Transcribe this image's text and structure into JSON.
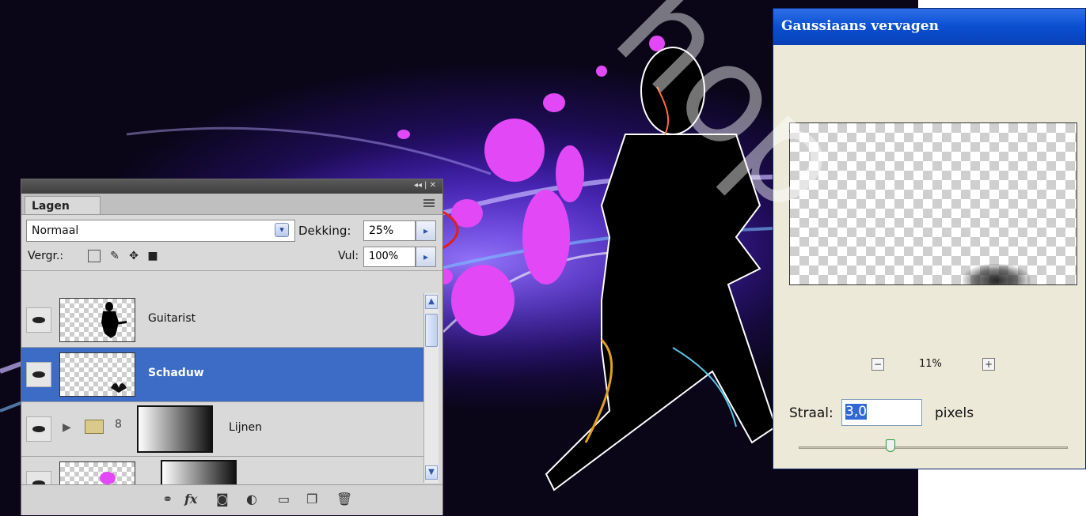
{
  "layers_panel": {
    "tab_label": "Lagen",
    "blend_mode": "Normaal",
    "opacity_label": "Dekking:",
    "opacity_value": "25%",
    "lock_label": "Vergr.:",
    "fill_label": "Vul:",
    "fill_value": "100%",
    "layers": [
      {
        "name": "Guitarist",
        "selected": false
      },
      {
        "name": "Schaduw",
        "selected": true
      },
      {
        "name": "Lijnen",
        "selected": false,
        "group": true
      }
    ],
    "footer_icons": [
      "link-icon",
      "fx-icon",
      "mask-icon",
      "adjustment-icon",
      "folder-icon",
      "new-layer-icon",
      "trash-icon"
    ]
  },
  "gauss_dialog": {
    "title": "Gaussiaans vervagen",
    "zoom": "11%",
    "radius_label": "Straal:",
    "radius_value": "3,0",
    "radius_unit": "pixels",
    "slider_level": 0.35
  },
  "watermark": "hop",
  "colors": {
    "selection": "#3d6cc6",
    "dialog_title": "#0a4fd1",
    "annotation_circle": "#e0201c",
    "splash": "#e040ff"
  }
}
